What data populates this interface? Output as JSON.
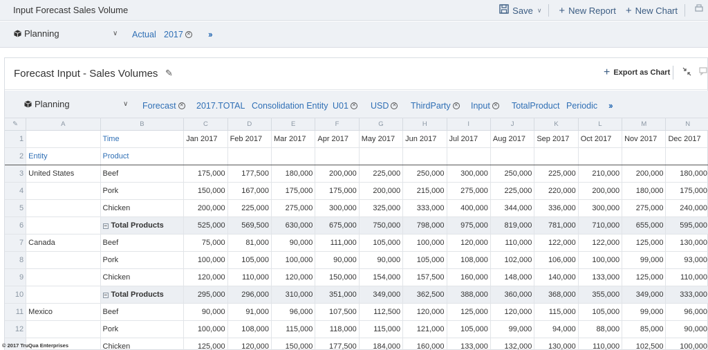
{
  "window": {
    "title": "Input Forecast Sales Volume"
  },
  "toolbar": {
    "save_label": "Save",
    "new_report_label": "New Report",
    "new_chart_label": "New Chart"
  },
  "planning_bar": {
    "label": "Planning",
    "pov": [
      {
        "label": "Actual",
        "clearable": false
      },
      {
        "label": "2017",
        "clearable": true
      }
    ]
  },
  "panel": {
    "title": "Forecast Input - Sales Volumes",
    "export_label": "Export as Chart",
    "dimbar": {
      "label": "Planning",
      "pov": [
        {
          "label": "Forecast",
          "clearable": true
        },
        {
          "label": "2017.TOTAL",
          "clearable": false
        },
        {
          "label": "Consolidation Entity",
          "clearable": false
        },
        {
          "label": "U01",
          "clearable": true
        },
        {
          "label": "USD",
          "clearable": true
        },
        {
          "label": "ThirdParty",
          "clearable": true
        },
        {
          "label": "Input",
          "clearable": true
        },
        {
          "label": "TotalProduct",
          "clearable": false
        },
        {
          "label": "Periodic",
          "clearable": false
        }
      ]
    }
  },
  "grid": {
    "column_letters": [
      "A",
      "B",
      "C",
      "D",
      "E",
      "F",
      "G",
      "H",
      "I",
      "J",
      "K",
      "L",
      "M",
      "N"
    ],
    "row_header_label_time": "Time",
    "row_header_label_entity": "Entity",
    "row_header_label_product": "Product",
    "months": [
      "Jan 2017",
      "Feb 2017",
      "Mar 2017",
      "Apr 2017",
      "May 2017",
      "Jun 2017",
      "Jul 2017",
      "Aug 2017",
      "Sep 2017",
      "Oct 2017",
      "Nov 2017",
      "Dec 2017"
    ],
    "rows": [
      {
        "n": "3",
        "entity": "United States",
        "product": "Beef",
        "total": false,
        "values": [
          "175,000",
          "177,500",
          "180,000",
          "200,000",
          "225,000",
          "250,000",
          "300,000",
          "250,000",
          "225,000",
          "210,000",
          "200,000",
          "180,000"
        ]
      },
      {
        "n": "4",
        "entity": "",
        "product": "Pork",
        "total": false,
        "values": [
          "150,000",
          "167,000",
          "175,000",
          "175,000",
          "200,000",
          "215,000",
          "275,000",
          "225,000",
          "220,000",
          "200,000",
          "180,000",
          "175,000"
        ]
      },
      {
        "n": "5",
        "entity": "",
        "product": "Chicken",
        "total": false,
        "values": [
          "200,000",
          "225,000",
          "275,000",
          "300,000",
          "325,000",
          "333,000",
          "400,000",
          "344,000",
          "336,000",
          "300,000",
          "275,000",
          "240,000"
        ]
      },
      {
        "n": "6",
        "entity": "",
        "product": "Total Products",
        "total": true,
        "values": [
          "525,000",
          "569,500",
          "630,000",
          "675,000",
          "750,000",
          "798,000",
          "975,000",
          "819,000",
          "781,000",
          "710,000",
          "655,000",
          "595,000"
        ]
      },
      {
        "n": "7",
        "entity": "Canada",
        "product": "Beef",
        "total": false,
        "values": [
          "75,000",
          "81,000",
          "90,000",
          "111,000",
          "105,000",
          "100,000",
          "120,000",
          "110,000",
          "122,000",
          "122,000",
          "125,000",
          "130,000"
        ]
      },
      {
        "n": "8",
        "entity": "",
        "product": "Pork",
        "total": false,
        "values": [
          "100,000",
          "105,000",
          "100,000",
          "90,000",
          "90,000",
          "105,000",
          "108,000",
          "102,000",
          "106,000",
          "100,000",
          "99,000",
          "93,000"
        ]
      },
      {
        "n": "9",
        "entity": "",
        "product": "Chicken",
        "total": false,
        "values": [
          "120,000",
          "110,000",
          "120,000",
          "150,000",
          "154,000",
          "157,500",
          "160,000",
          "148,000",
          "140,000",
          "133,000",
          "125,000",
          "110,000"
        ]
      },
      {
        "n": "10",
        "entity": "",
        "product": "Total Products",
        "total": true,
        "values": [
          "295,000",
          "296,000",
          "310,000",
          "351,000",
          "349,000",
          "362,500",
          "388,000",
          "360,000",
          "368,000",
          "355,000",
          "349,000",
          "333,000"
        ]
      },
      {
        "n": "11",
        "entity": "Mexico",
        "product": "Beef",
        "total": false,
        "values": [
          "90,000",
          "91,000",
          "96,000",
          "107,500",
          "112,500",
          "120,000",
          "125,000",
          "120,000",
          "115,000",
          "105,000",
          "99,000",
          "96,000"
        ]
      },
      {
        "n": "12",
        "entity": "",
        "product": "Pork",
        "total": false,
        "values": [
          "100,000",
          "108,000",
          "115,000",
          "118,000",
          "115,000",
          "121,000",
          "105,000",
          "99,000",
          "94,000",
          "88,000",
          "85,000",
          "90,000"
        ]
      },
      {
        "n": "",
        "entity": "",
        "product": "Chicken",
        "total": false,
        "values": [
          "125,000",
          "120,000",
          "150,000",
          "177,500",
          "184,000",
          "160,000",
          "133,000",
          "132,000",
          "130,000",
          "110,000",
          "102,500",
          "100,000"
        ]
      }
    ]
  },
  "footer": {
    "copyright": "© 2017 TruQua Enterprises"
  },
  "colors": {
    "accent": "#2f6fb5",
    "toolbar_bg": "#eef1f5",
    "total_row_bg": "#eceff3"
  }
}
